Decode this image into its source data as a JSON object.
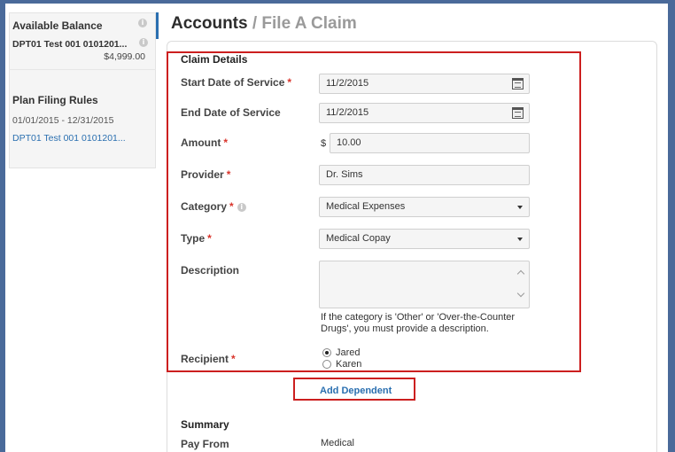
{
  "sidebar": {
    "title": "Available Balance",
    "account_name": "DPT01 Test 001 0101201...",
    "balance": "$4,999.00",
    "rules_title": "Plan Filing Rules",
    "date_range": "01/01/2015 - 12/31/2015",
    "account_link": "DPT01 Test 001 0101201..."
  },
  "header": {
    "title": "Accounts",
    "separator": "/",
    "subtitle": "File A Claim"
  },
  "claim": {
    "heading": "Claim Details",
    "start_date_label": "Start Date of Service",
    "start_date_value": "11/2/2015",
    "end_date_label": "End Date of Service",
    "end_date_value": "11/2/2015",
    "amount_label": "Amount",
    "currency": "$",
    "amount_value": "10.00",
    "provider_label": "Provider",
    "provider_value": "Dr. Sims",
    "category_label": "Category",
    "category_value": "Medical Expenses",
    "type_label": "Type",
    "type_value": "Medical Copay",
    "description_label": "Description",
    "description_help": "If the category is 'Other' or 'Over-the-Counter Drugs', you must provide a description.",
    "recipient_label": "Recipient",
    "recipients": [
      {
        "name": "Jared",
        "selected": true
      },
      {
        "name": "Karen",
        "selected": false
      }
    ],
    "add_dependent": "Add Dependent",
    "required_mark": "*"
  },
  "summary": {
    "heading": "Summary",
    "pay_from_label": "Pay From",
    "pay_from_value": "Medical"
  },
  "colors": {
    "frame": "#4a6a9a",
    "link": "#2a6fb0",
    "required": "#d9342b",
    "highlight": "#cc1f1f"
  },
  "icons": [
    "info-icon",
    "calendar-icon",
    "chevron-down-icon",
    "scroll-up-icon",
    "scroll-down-icon",
    "radio-icon"
  ]
}
